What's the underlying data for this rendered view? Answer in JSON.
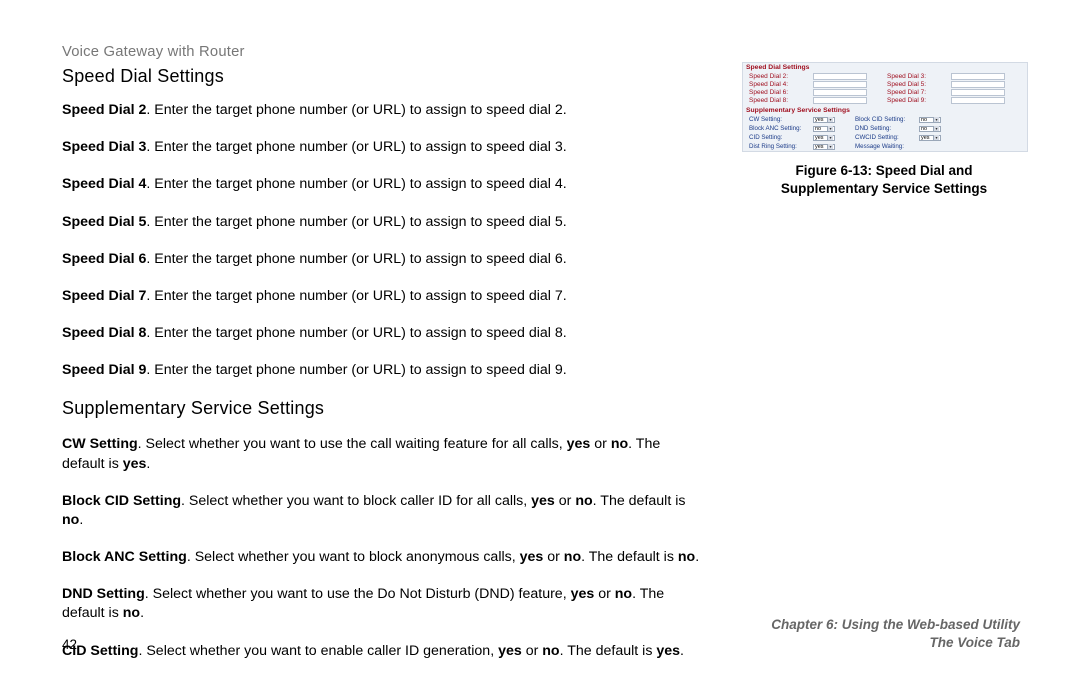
{
  "header": {
    "product_line": "Voice Gateway with Router"
  },
  "section1": {
    "title": "Speed Dial Settings",
    "items": [
      {
        "label": "Speed Dial 2",
        "after": ". Enter the target phone number (or URL) to assign to speed dial 2."
      },
      {
        "label": "Speed Dial 3",
        "after": ". Enter the target phone number (or URL) to assign to speed dial 3."
      },
      {
        "label": "Speed Dial 4",
        "after": ". Enter the target phone number (or URL) to assign to speed dial 4."
      },
      {
        "label": "Speed Dial 5",
        "after": ". Enter the target phone number (or URL) to assign to speed dial 5."
      },
      {
        "label": "Speed Dial 6",
        "after": ". Enter the target phone number (or URL) to assign to speed dial 6."
      },
      {
        "label": "Speed Dial 7",
        "after": ". Enter the target phone number (or URL) to assign to speed dial 7."
      },
      {
        "label": "Speed Dial 8",
        "after": ". Enter the target phone number (or URL) to assign to speed dial 8."
      },
      {
        "label": "Speed Dial 9",
        "after": ". Enter the target phone number (or URL) to assign to speed dial 9."
      }
    ]
  },
  "section2": {
    "title": "Supplementary Service Settings",
    "items": [
      {
        "label": "CW Setting",
        "t1": ". Select whether you want to use the call waiting feature for all calls, ",
        "y": "yes",
        "t2": " or ",
        "n": "no",
        "t3": ". The default is ",
        "d": "yes",
        "end": "."
      },
      {
        "label": "Block CID Setting",
        "t1": ". Select whether you want to block caller ID for all calls, ",
        "y": "yes",
        "t2": " or ",
        "n": "no",
        "t3": ". The default is ",
        "d": "no",
        "end": "."
      },
      {
        "label": "Block ANC Setting",
        "t1": ". Select whether you want to block anonymous calls, ",
        "y": "yes",
        "t2": " or ",
        "n": "no",
        "t3": ". The default is ",
        "d": "no",
        "end": "."
      },
      {
        "label": "DND Setting",
        "t1": ". Select whether you want to use the Do Not Disturb (DND) feature, ",
        "y": "yes",
        "t2": " or ",
        "n": "no",
        "t3": ". The default is ",
        "d": "no",
        "end": "."
      },
      {
        "label": "CID Setting",
        "t1": ". Select whether you want to enable caller ID generation, ",
        "y": "yes",
        "t2": " or ",
        "n": "no",
        "t3": ". The default is ",
        "d": "yes",
        "end": "."
      }
    ]
  },
  "figure": {
    "caption_line1": "Figure 6-13: Speed Dial and",
    "caption_line2": "Supplementary Service Settings",
    "header1": "Speed Dial Settings",
    "speed": [
      {
        "l": "Speed Dial 2:",
        "r": "Speed Dial 3:"
      },
      {
        "l": "Speed Dial 4:",
        "r": "Speed Dial 5:"
      },
      {
        "l": "Speed Dial 6:",
        "r": "Speed Dial 7:"
      },
      {
        "l": "Speed Dial 8:",
        "r": "Speed Dial 9:"
      }
    ],
    "header2": "Supplementary Service Settings",
    "supp": [
      {
        "l": "CW Setting:",
        "lv": "yes",
        "r": "Block CID Setting:",
        "rv": "no"
      },
      {
        "l": "Block ANC Setting:",
        "lv": "no",
        "r": "DND Setting:",
        "rv": "no"
      },
      {
        "l": "CID Setting:",
        "lv": "yes",
        "r": "CWCID Setting:",
        "rv": "yes"
      },
      {
        "l": "Dist Ring Setting:",
        "lv": "yes",
        "r": "Message Waiting:",
        "rv": ""
      }
    ]
  },
  "footer": {
    "page": "42",
    "chapter": "Chapter 6: Using the Web-based Utility",
    "sub": "The Voice Tab"
  }
}
